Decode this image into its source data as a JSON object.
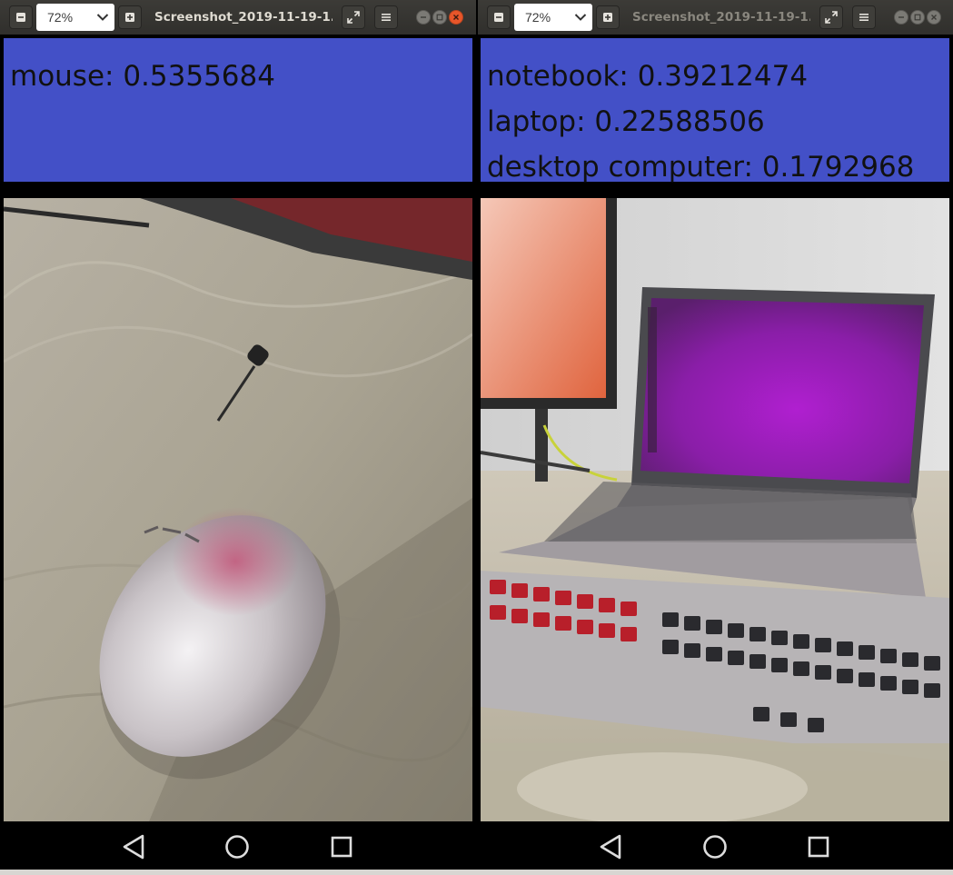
{
  "windows": [
    {
      "zoom": "72%",
      "title": "Screenshot_2019-11-19-1...",
      "predictions": [
        {
          "text": "mouse: 0.5355684"
        }
      ]
    },
    {
      "zoom": "72%",
      "title": "Screenshot_2019-11-19-1...",
      "predictions": [
        {
          "text": "notebook: 0.39212474"
        },
        {
          "text": "laptop: 0.22588506"
        },
        {
          "text": "desktop computer: 0.1792968"
        }
      ]
    }
  ],
  "colors": {
    "prediction_panel": "#4350c7",
    "titlebar": "#3c3b37",
    "close_button": "#e8562a"
  },
  "icons": {
    "zoom_out": "minus-icon",
    "zoom_in": "plus-icon",
    "dropdown": "chevron-down-icon",
    "fullscreen": "expand-icon",
    "menu": "hamburger-menu-icon",
    "nav_back": "triangle-back-icon",
    "nav_home": "circle-home-icon",
    "nav_recents": "square-recents-icon"
  }
}
